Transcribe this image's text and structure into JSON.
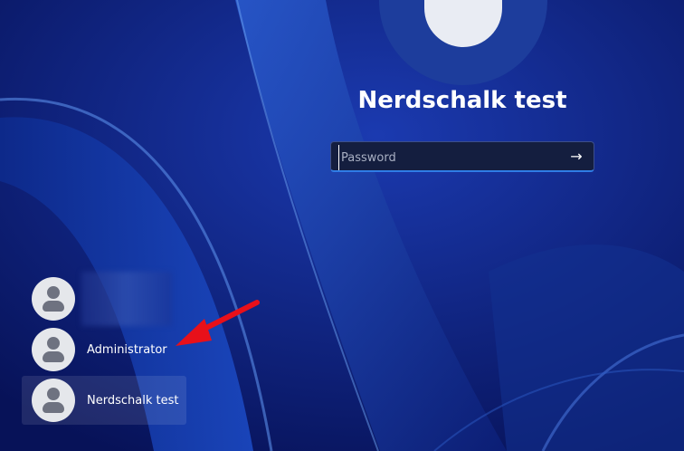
{
  "login": {
    "username": "Nerdschalk test",
    "password_placeholder": "Password",
    "submit_icon": "arrow-right-icon"
  },
  "users": [
    {
      "name": "",
      "avatar_icon": "user-avatar-icon",
      "name_blurred": true
    },
    {
      "name": "Administrator",
      "avatar_icon": "user-avatar-icon"
    },
    {
      "name": "Nerdschalk test",
      "avatar_icon": "user-avatar-icon",
      "selected": true
    }
  ],
  "annotation": {
    "arrow_icon": "red-arrow-icon",
    "color": "#e8101a"
  },
  "colors": {
    "accent": "#2f7ce6",
    "background": "#0a1a6a"
  }
}
